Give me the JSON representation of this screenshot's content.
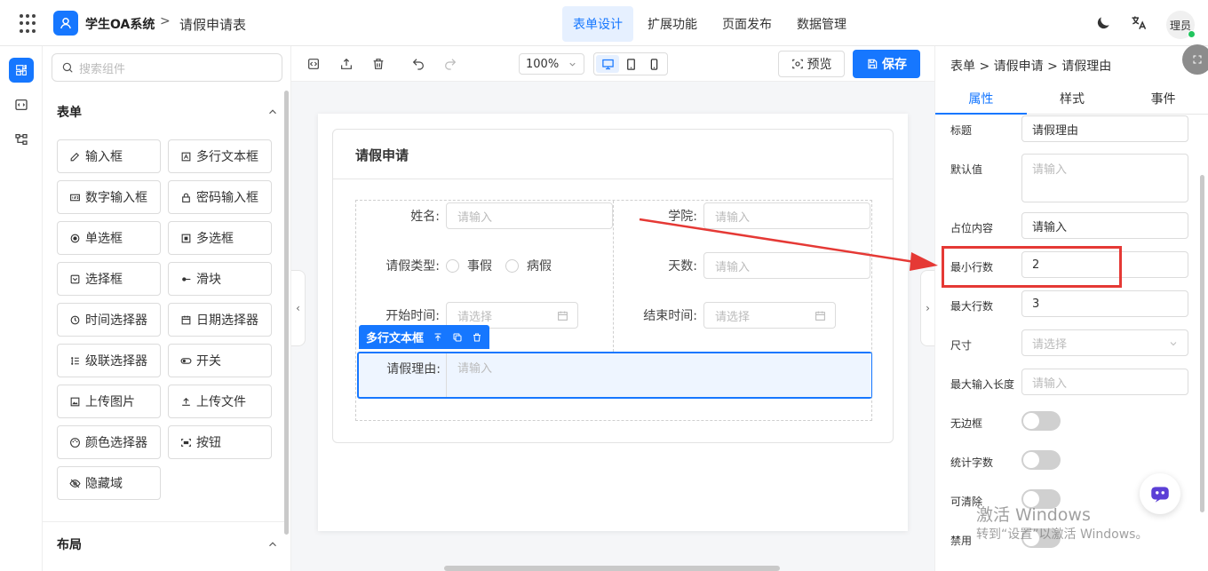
{
  "topbar": {
    "app_name": "学生OA系统",
    "separator": ">",
    "page_name": "请假申请表",
    "nav": [
      "表单设计",
      "扩展功能",
      "页面发布",
      "数据管理"
    ],
    "nav_active": "表单设计",
    "user_label": "理员"
  },
  "left_rail": {
    "icons": [
      "puzzle-icon",
      "code-icon",
      "flow-icon"
    ]
  },
  "components": {
    "search_placeholder": "搜索组件",
    "section_form": "表单",
    "items": [
      "输入框",
      "多行文本框",
      "数字输入框",
      "密码输入框",
      "单选框",
      "多选框",
      "选择框",
      "滑块",
      "时间选择器",
      "日期选择器",
      "级联选择器",
      "开关",
      "上传图片",
      "上传文件",
      "颜色选择器",
      "按钮",
      "隐藏域"
    ],
    "section_layout": "布局"
  },
  "toolbar": {
    "zoom": "100%",
    "preview_label": "预览",
    "save_label": "保存"
  },
  "form": {
    "title": "请假申请",
    "fields": {
      "name_label": "姓名:",
      "name_placeholder": "请输入",
      "college_label": "学院:",
      "college_placeholder": "请输入",
      "leave_type_label": "请假类型:",
      "leave_options": [
        "事假",
        "病假"
      ],
      "days_label": "天数:",
      "days_placeholder": "请输入",
      "start_label": "开始时间:",
      "start_placeholder": "请选择",
      "end_label": "结束时间:",
      "end_placeholder": "请选择",
      "reason_label": "请假理由:",
      "reason_placeholder": "请输入"
    },
    "selected_tag": "多行文本框"
  },
  "props": {
    "breadcrumb": [
      "表单",
      "请假申请",
      "请假理由"
    ],
    "tabs": [
      "属性",
      "样式",
      "事件"
    ],
    "active_tab": "属性",
    "title_label": "标题",
    "title_value": "请假理由",
    "default_label": "默认值",
    "default_placeholder": "请输入",
    "placeholder_label": "占位内容",
    "placeholder_value": "请输入",
    "min_rows_label": "最小行数",
    "min_rows_value": "2",
    "max_rows_label": "最大行数",
    "max_rows_value": "3",
    "size_label": "尺寸",
    "size_placeholder": "请选择",
    "maxlen_label": "最大输入长度",
    "maxlen_placeholder": "请输入",
    "borderless_label": "无边框",
    "borderless": false,
    "wordcount_label": "统计字数",
    "wordcount": false,
    "clearable_label": "可清除",
    "clearable": false,
    "disabled_label": "禁用",
    "disabled": false
  },
  "watermark": {
    "line1": "激活 Windows",
    "line2": "转到“设置”以激活 Windows。"
  },
  "colors": {
    "accent": "#1677ff",
    "annotation": "#e53935"
  }
}
